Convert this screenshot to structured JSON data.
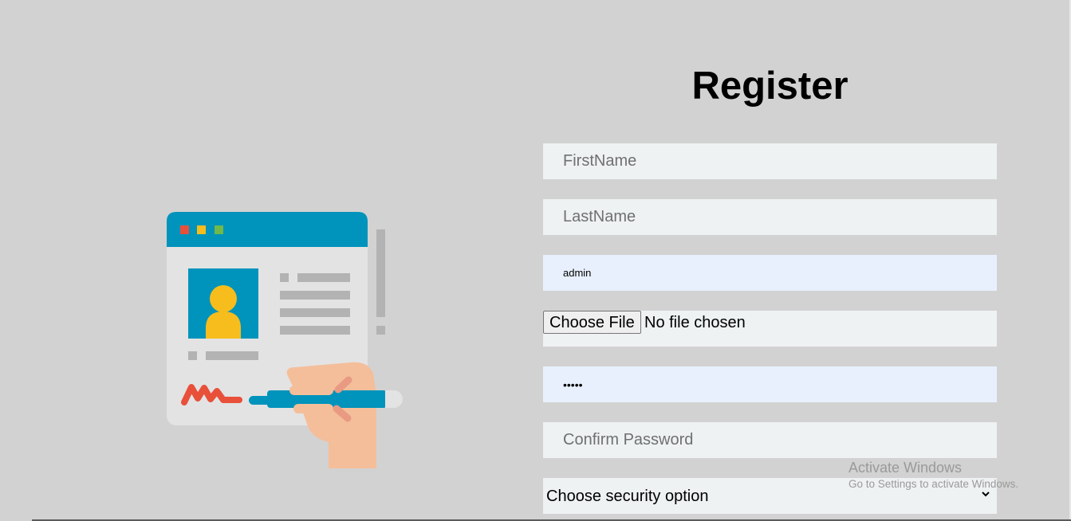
{
  "form": {
    "title": "Register",
    "first_name_placeholder": "FirstName",
    "last_name_placeholder": "LastName",
    "username_value": "admin",
    "file_button_label": "Choose File",
    "file_status": "No file chosen",
    "password_value": "admin",
    "confirm_password_placeholder": "Confirm Password",
    "security_select_value": "Choose security option"
  },
  "colors": {
    "background": "#d2d2d2",
    "input_background": "#eef2f3",
    "autofill_background": "#e8f0fe",
    "card_header": "#0093bb",
    "avatar_yellow": "#f6bd1d",
    "scribble_red": "#e8503a",
    "hand_skin": "#f4be9a"
  },
  "illustration": {
    "icon": "registration-form-illustration-icon"
  },
  "watermark": {
    "title": "Activate Windows",
    "subtitle": "Go to Settings to activate Windows."
  }
}
